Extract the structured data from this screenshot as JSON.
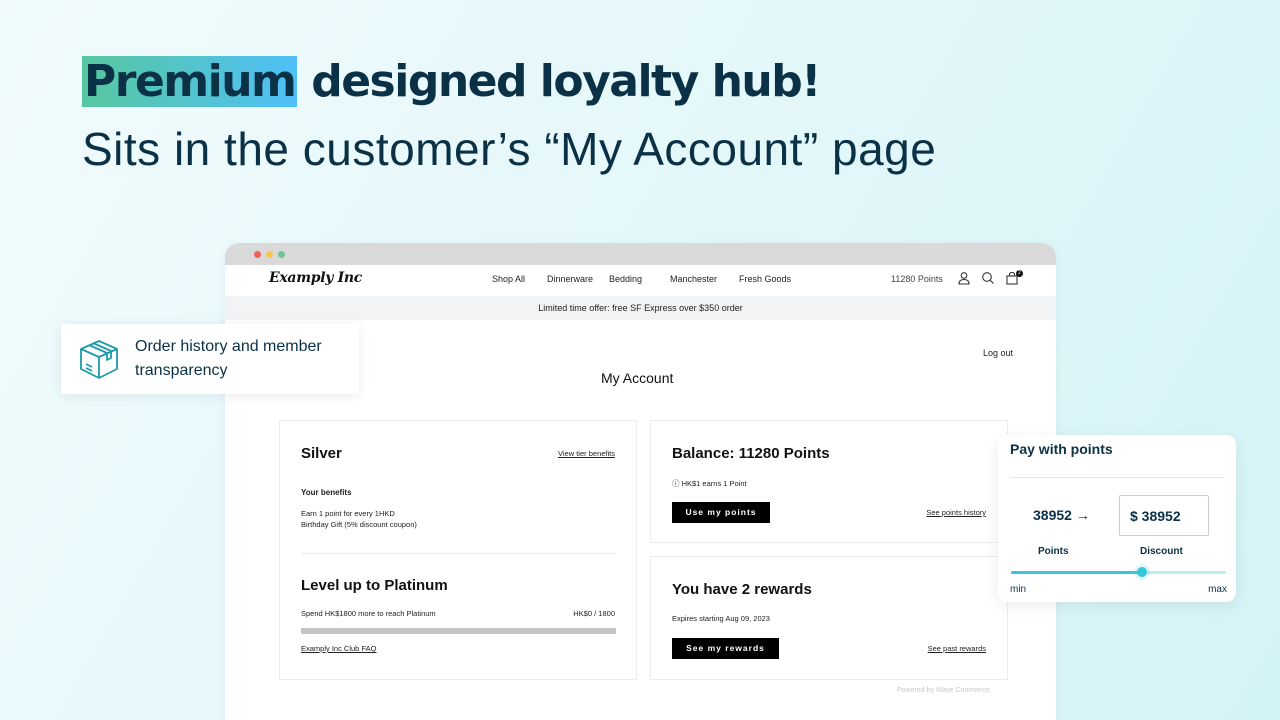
{
  "hero": {
    "highlight": "Premium",
    "headline_rest": " designed loyalty hub!",
    "subline": "Sits in the customer’s “My Account” page"
  },
  "callout": {
    "icon": "package-box-icon",
    "text_line1": "Order history and member",
    "text_line2": "transparency",
    "accent_color": "#1f9aaa"
  },
  "store": {
    "logo": "Examply Inc",
    "nav": [
      "Shop All",
      "Dinnerware",
      "Bedding",
      "Manchester",
      "Fresh Goods"
    ],
    "points_label": "11280 Points",
    "cart_count": "2",
    "promo": "Limited time offer: free SF Express over $350 order",
    "logout": "Log out",
    "page_title": "My Account",
    "powered_by": "Powered by Wave Commerce"
  },
  "tier_card": {
    "tier": "Silver",
    "view_benefits": "View tier benefits",
    "benefits_heading": "Your benefits",
    "benefits": [
      "Earn 1 point for every 1HKD",
      "Birthday Gift (5% discount coupon)"
    ],
    "levelup_title": "Level up to Platinum",
    "levelup_desc": "Spend HK$1800 more to reach Platinum",
    "levelup_progress_label": "HK$0 / 1800",
    "levelup_progress_fraction": 0,
    "faq_link": "Examply Inc Club FAQ"
  },
  "balance_card": {
    "title": "Balance: 11280 Points",
    "info": "ⓘ HK$1 earns 1 Point",
    "button": "Use my points",
    "history_link": "See points history"
  },
  "rewards_card": {
    "title": "You have 2 rewards",
    "expires": "Expires starting Aug 09, 2023",
    "button": "See my rewards",
    "past_link": "See past rewards"
  },
  "pay_widget": {
    "title": "Pay with points",
    "points_value": "38952 →",
    "discount_value": "$ 38952",
    "points_label": "Points",
    "discount_label": "Discount",
    "slider_fraction": 0.61,
    "min_label": "min",
    "max_label": "max",
    "accent_color": "#36c6de"
  }
}
